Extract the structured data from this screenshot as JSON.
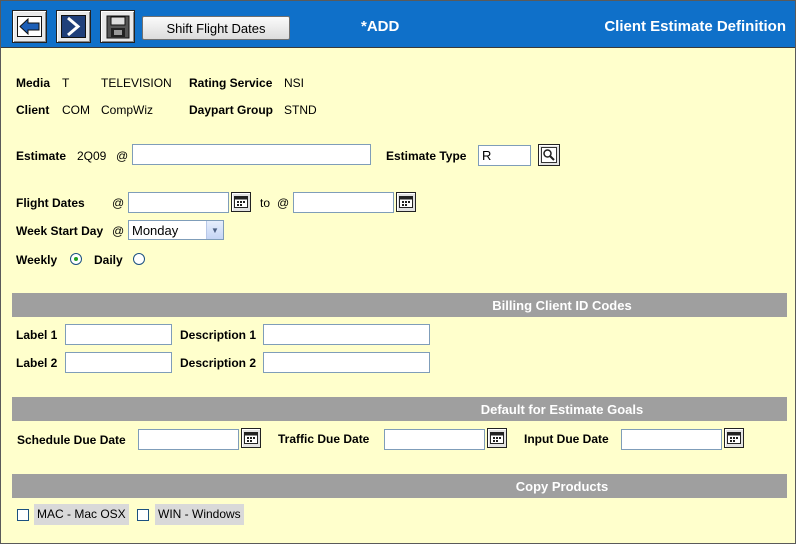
{
  "toolbar": {
    "back_icon": "back-arrow-icon",
    "next_icon": "next-chevron-icon",
    "save_icon": "save-icon",
    "shift_label": "Shift Flight Dates",
    "mode": "*ADD",
    "title": "Client Estimate Definition"
  },
  "header": {
    "media_label": "Media",
    "media_code": "T",
    "media_name": "TELEVISION",
    "rating_label": "Rating Service",
    "rating_value": "NSI",
    "client_label": "Client",
    "client_code": "COM",
    "client_name": "CompWiz",
    "daypart_label": "Daypart Group",
    "daypart_value": "STND"
  },
  "estimate": {
    "label": "Estimate",
    "code": "2Q09",
    "at": "@",
    "value": "",
    "type_label": "Estimate Type",
    "type_value": "R"
  },
  "flight": {
    "label": "Flight Dates",
    "at": "@",
    "start": "",
    "to": "to",
    "at2": "@",
    "end": "",
    "week_start_label": "Week Start Day",
    "week_at": "@",
    "week_start_value": "Monday",
    "weekly_label": "Weekly",
    "daily_label": "Daily",
    "selected": "weekly"
  },
  "billing": {
    "section_title": "Billing Client ID Codes",
    "label1": "Label 1",
    "desc1": "Description 1",
    "label2": "Label 2",
    "desc2": "Description 2",
    "label1_value": "",
    "desc1_value": "",
    "label2_value": "",
    "desc2_value": ""
  },
  "goals": {
    "section_title": "Default for Estimate Goals",
    "schedule_label": "Schedule Due Date",
    "traffic_label": "Traffic Due Date",
    "input_label": "Input Due Date",
    "schedule_value": "",
    "traffic_value": "",
    "input_value": ""
  },
  "products": {
    "section_title": "Copy Products",
    "items": [
      {
        "label": "MAC - Mac OSX",
        "checked": false
      },
      {
        "label": "WIN - Windows",
        "checked": false
      }
    ]
  }
}
